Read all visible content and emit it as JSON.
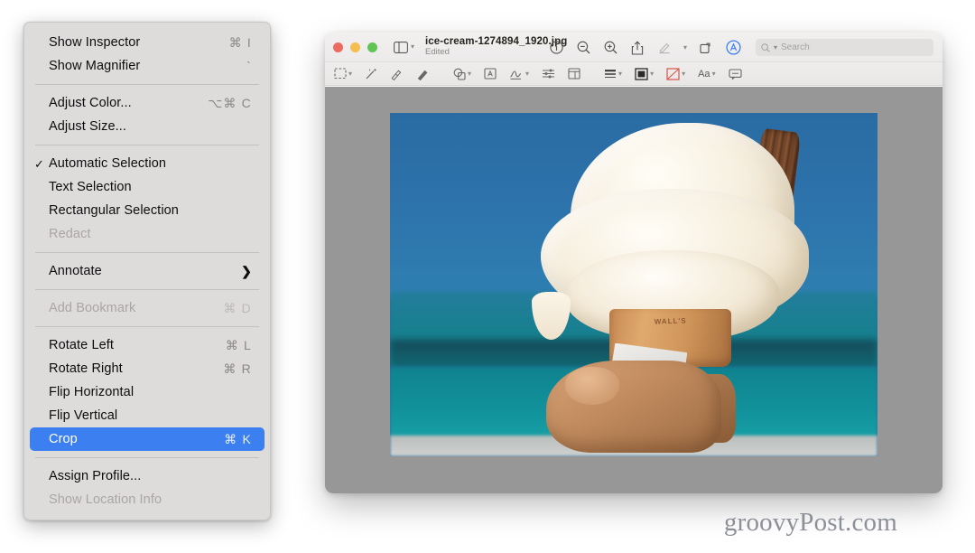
{
  "context_menu": {
    "name": "preview-tools-menu",
    "items": [
      {
        "label": "Show Inspector",
        "shortcut": "⌘ I",
        "state": "normal",
        "checked": false,
        "submenu": false
      },
      {
        "label": "Show Magnifier",
        "shortcut": "`",
        "state": "normal",
        "checked": false,
        "submenu": false
      },
      {
        "separator": true
      },
      {
        "label": "Adjust Color...",
        "shortcut": "⌥⌘ C",
        "state": "normal",
        "checked": false,
        "submenu": false
      },
      {
        "label": "Adjust Size...",
        "shortcut": "",
        "state": "normal",
        "checked": false,
        "submenu": false
      },
      {
        "separator": true
      },
      {
        "label": "Automatic Selection",
        "shortcut": "",
        "state": "normal",
        "checked": true,
        "submenu": false
      },
      {
        "label": "Text Selection",
        "shortcut": "",
        "state": "normal",
        "checked": false,
        "submenu": false
      },
      {
        "label": "Rectangular Selection",
        "shortcut": "",
        "state": "normal",
        "checked": false,
        "submenu": false
      },
      {
        "label": "Redact",
        "shortcut": "",
        "state": "disabled",
        "checked": false,
        "submenu": false
      },
      {
        "separator": true
      },
      {
        "label": "Annotate",
        "shortcut": "",
        "state": "normal",
        "checked": false,
        "submenu": true
      },
      {
        "separator": true
      },
      {
        "label": "Add Bookmark",
        "shortcut": "⌘ D",
        "state": "disabled",
        "checked": false,
        "submenu": false
      },
      {
        "separator": true
      },
      {
        "label": "Rotate Left",
        "shortcut": "⌘ L",
        "state": "normal",
        "checked": false,
        "submenu": false
      },
      {
        "label": "Rotate Right",
        "shortcut": "⌘ R",
        "state": "normal",
        "checked": false,
        "submenu": false
      },
      {
        "label": "Flip Horizontal",
        "shortcut": "",
        "state": "normal",
        "checked": false,
        "submenu": false
      },
      {
        "label": "Flip Vertical",
        "shortcut": "",
        "state": "normal",
        "checked": false,
        "submenu": false
      },
      {
        "label": "Crop",
        "shortcut": "⌘ K",
        "state": "selected",
        "checked": false,
        "submenu": false
      },
      {
        "separator": true
      },
      {
        "label": "Assign Profile...",
        "shortcut": "",
        "state": "normal",
        "checked": false,
        "submenu": false
      },
      {
        "label": "Show Location Info",
        "shortcut": "",
        "state": "disabled",
        "checked": false,
        "submenu": false
      }
    ],
    "checkmark_glyph": "✓",
    "submenu_glyph": "❯",
    "highlight_color": "#3b7ff0",
    "background_color": "#dedbdb"
  },
  "window": {
    "document_title": "ice-cream-1274894_1920.jpg",
    "document_status": "Edited",
    "traffic_lights": [
      {
        "name": "close-button",
        "color": "#ec6a5f"
      },
      {
        "name": "minimize-button",
        "color": "#f4bf4f"
      },
      {
        "name": "maximize-button",
        "color": "#61c454"
      }
    ],
    "sidebar_toggle": {
      "name": "sidebar-toggle-button",
      "chevron": "⌄"
    },
    "toolbar_right": [
      {
        "name": "info-button",
        "icon": "info-icon"
      },
      {
        "name": "zoom-out-button",
        "icon": "zoom-out-icon"
      },
      {
        "name": "zoom-in-button",
        "icon": "zoom-in-icon"
      },
      {
        "name": "share-button",
        "icon": "share-icon"
      },
      {
        "name": "markup-button",
        "icon": "markup-pen-icon"
      },
      {
        "name": "markup-dropdown",
        "icon": "chevron-down-icon"
      },
      {
        "name": "rotate-button",
        "icon": "rotate-icon"
      },
      {
        "name": "annotate-button",
        "icon": "annotate-circle-a-icon"
      }
    ],
    "search": {
      "placeholder": "Search",
      "value": ""
    },
    "markup_bar": [
      {
        "name": "selection-tool",
        "icon": "rect-selection-icon",
        "has_chevron": true
      },
      {
        "name": "instant-alpha-tool",
        "icon": "magic-wand-icon",
        "has_chevron": false
      },
      {
        "name": "sketch-tool",
        "icon": "sketch-icon",
        "has_chevron": false
      },
      {
        "name": "draw-tool",
        "icon": "draw-icon",
        "has_chevron": false
      },
      {
        "name": "shapes-tool",
        "icon": "shapes-icon",
        "has_chevron": true
      },
      {
        "name": "text-tool",
        "icon": "text-box-icon",
        "has_chevron": false
      },
      {
        "name": "sign-tool",
        "icon": "signature-icon",
        "has_chevron": true
      },
      {
        "name": "adjust-color-tool",
        "icon": "sliders-icon",
        "has_chevron": false
      },
      {
        "name": "adjust-size-tool",
        "icon": "crop-size-icon",
        "has_chevron": false
      },
      {
        "name": "shape-style-tool",
        "icon": "shape-style-icon",
        "has_chevron": true
      },
      {
        "name": "fill-color-tool",
        "icon": "fill-color-icon",
        "has_chevron": true
      },
      {
        "name": "border-color-tool",
        "icon": "border-color-icon",
        "has_chevron": true
      },
      {
        "name": "text-style-tool",
        "icon": "text-style-aa-icon",
        "has_chevron": true,
        "label": "Aa"
      },
      {
        "name": "note-tool",
        "icon": "note-icon",
        "has_chevron": false
      }
    ],
    "canvas_background": "#979797"
  },
  "photo": {
    "alt": "ice cream cone with chocolate flake held in a hand by the sea",
    "cone_text": "WALL'S"
  },
  "watermark": {
    "text": "groovyPost.com"
  }
}
